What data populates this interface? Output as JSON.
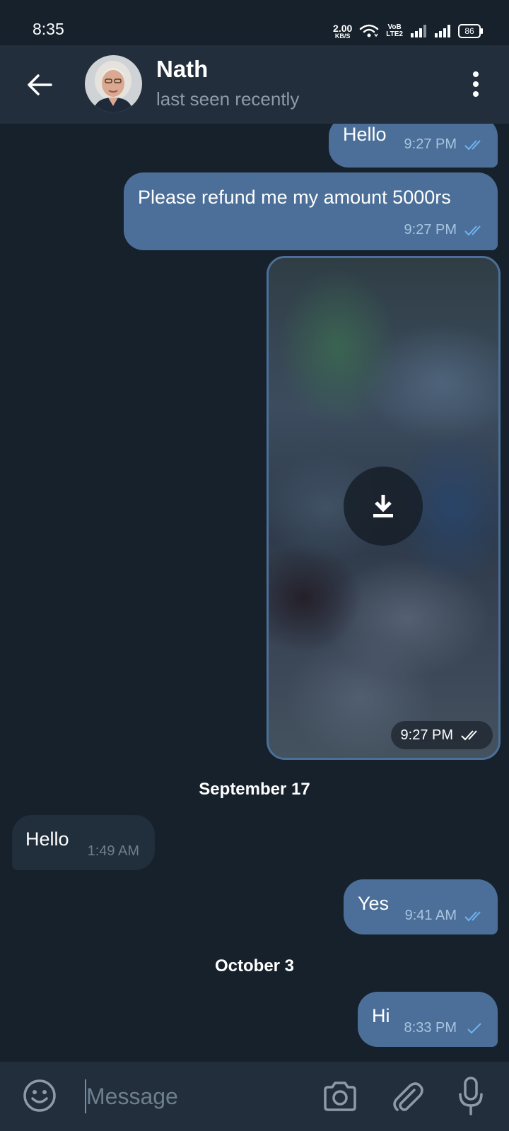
{
  "status_bar": {
    "time": "8:35",
    "net_speed_value": "2.00",
    "net_speed_unit": "KB/S",
    "volte_top": "VoB",
    "volte_bottom": "LTE2",
    "battery": "86"
  },
  "header": {
    "contact_name": "Nath",
    "contact_status": "last seen recently"
  },
  "messages": [
    {
      "direction": "out",
      "text": "Hello",
      "time": "9:27 PM",
      "status": "read"
    },
    {
      "direction": "out",
      "text": "Please refund me my amount 5000rs",
      "time": "9:27 PM",
      "status": "read"
    },
    {
      "direction": "out",
      "type": "media",
      "time": "9:27 PM",
      "status": "read"
    },
    {
      "direction": "in",
      "text": "Hello",
      "time": "1:49 AM"
    },
    {
      "direction": "out",
      "text": "Yes",
      "time": "9:41 AM",
      "status": "read"
    },
    {
      "direction": "out",
      "text": "Hi",
      "time": "8:33 PM",
      "status": "sent"
    }
  ],
  "date_separators": [
    "September 17",
    "October 3"
  ],
  "input": {
    "placeholder": "Message"
  },
  "icons": {
    "back": "arrow-left-icon",
    "menu": "more-vertical-icon",
    "download": "download-icon",
    "emoji": "smiley-icon",
    "camera": "camera-icon",
    "attach": "paperclip-icon",
    "mic": "microphone-icon",
    "read": "double-check-icon",
    "sent": "single-check-icon"
  },
  "colors": {
    "background": "#17212b",
    "header": "#232e3c",
    "outgoing_bubble": "#4b6f98",
    "incoming_bubble": "#212e3b",
    "tick": "#6fb4f0"
  }
}
